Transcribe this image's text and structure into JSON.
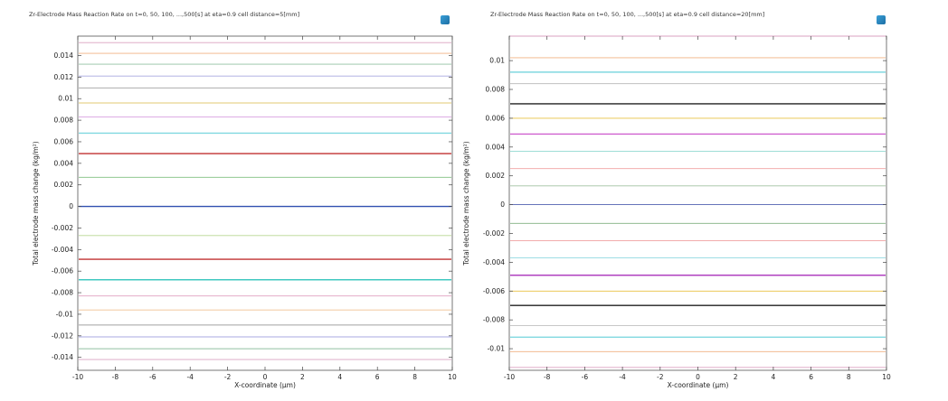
{
  "chart_data": [
    {
      "type": "line",
      "title": "Zr-Electrode Mass Reaction Rate on t=0, 50, 100, ...,500[s] at eta=0.9 cell distance=5[mm]",
      "xlabel": "X-coordinate (μm)",
      "ylabel": "Total electrode mass change (kg/m²)",
      "xlim": [
        -10,
        10
      ],
      "ylim": [
        -0.0152,
        0.0158
      ],
      "xticks": [
        -10,
        -8,
        -6,
        -4,
        -2,
        0,
        2,
        4,
        6,
        8,
        10
      ],
      "yticks": [
        0.014,
        0.012,
        0.01,
        0.008,
        0.006,
        0.004,
        0.002,
        0,
        -0.002,
        -0.004,
        -0.006,
        -0.008,
        -0.01,
        -0.012,
        -0.014
      ],
      "ytick_labels": [
        "0.014",
        "0.012",
        "0.01",
        "0.008",
        "0.006",
        "0.004",
        "0.002",
        "0",
        "-0.002",
        "-0.004",
        "-0.006",
        "-0.008",
        "-0.01",
        "-0.012",
        "-0.014"
      ],
      "grid": false,
      "series": [
        {
          "y": 0.0152,
          "color": "#d9a0c0"
        },
        {
          "y": 0.0142,
          "color": "#f0b080"
        },
        {
          "y": 0.0132,
          "color": "#90c0a0"
        },
        {
          "y": 0.0121,
          "color": "#a8a8e0"
        },
        {
          "y": 0.011,
          "color": "#a0a0a0"
        },
        {
          "y": 0.0096,
          "color": "#e0c870"
        },
        {
          "y": 0.0083,
          "color": "#d8a0e0"
        },
        {
          "y": 0.0068,
          "color": "#80d8e0"
        },
        {
          "y": 0.0049,
          "color": "#c03030"
        },
        {
          "y": 0.0027,
          "color": "#80c080"
        },
        {
          "y": 0.0,
          "color": "#3050b0"
        },
        {
          "y": -0.0027,
          "color": "#b8d890"
        },
        {
          "y": -0.0049,
          "color": "#c03030"
        },
        {
          "y": -0.0068,
          "color": "#40c8c0"
        },
        {
          "y": -0.0083,
          "color": "#e0a0c0"
        },
        {
          "y": -0.0096,
          "color": "#f0c090"
        },
        {
          "y": -0.011,
          "color": "#a0a0a0"
        },
        {
          "y": -0.0121,
          "color": "#a8a8e0"
        },
        {
          "y": -0.0132,
          "color": "#90c0a0"
        },
        {
          "y": -0.0142,
          "color": "#d9a0c0"
        }
      ]
    },
    {
      "type": "line",
      "title": "Zr-Electrode Mass Reaction Rate on t=0, 50, 100, ...,500[s] at eta=0.9 cell distance=20[mm]",
      "xlabel": "X-coordinate (μm)",
      "ylabel": "Total electrode mass change (kg/m²)",
      "xlim": [
        -10,
        10
      ],
      "ylim": [
        -0.0115,
        0.0117
      ],
      "xticks": [
        -10,
        -8,
        -6,
        -4,
        -2,
        0,
        2,
        4,
        6,
        8,
        10
      ],
      "yticks": [
        0.01,
        0.008,
        0.006,
        0.004,
        0.002,
        0,
        -0.002,
        -0.004,
        -0.006,
        -0.008,
        -0.01
      ],
      "ytick_labels": [
        "0.01",
        "0.008",
        "0.006",
        "0.004",
        "0.002",
        "0",
        "-0.002",
        "-0.004",
        "-0.006",
        "-0.008",
        "-0.01"
      ],
      "grid": false,
      "series": [
        {
          "y": 0.0117,
          "color": "#d9a0c0"
        },
        {
          "y": 0.0102,
          "color": "#f0b080"
        },
        {
          "y": 0.0092,
          "color": "#80d8e0"
        },
        {
          "y": 0.0084,
          "color": "#c0c0c0"
        },
        {
          "y": 0.007,
          "color": "#202020"
        },
        {
          "y": 0.006,
          "color": "#e8c040"
        },
        {
          "y": 0.0049,
          "color": "#d060d0"
        },
        {
          "y": 0.0037,
          "color": "#90d8d0"
        },
        {
          "y": 0.0025,
          "color": "#f0a0a0"
        },
        {
          "y": 0.0013,
          "color": "#a0c0a0"
        },
        {
          "y": 0.0,
          "color": "#5060b0"
        },
        {
          "y": -0.0013,
          "color": "#80b080"
        },
        {
          "y": -0.0025,
          "color": "#f0a0a0"
        },
        {
          "y": -0.0037,
          "color": "#90d8e0"
        },
        {
          "y": -0.0049,
          "color": "#b040c0"
        },
        {
          "y": -0.006,
          "color": "#e8c040"
        },
        {
          "y": -0.007,
          "color": "#202020"
        },
        {
          "y": -0.0084,
          "color": "#c0c0c0"
        },
        {
          "y": -0.0092,
          "color": "#80d8e0"
        },
        {
          "y": -0.0102,
          "color": "#f0b080"
        },
        {
          "y": -0.0113,
          "color": "#d9a0c0"
        }
      ]
    }
  ]
}
